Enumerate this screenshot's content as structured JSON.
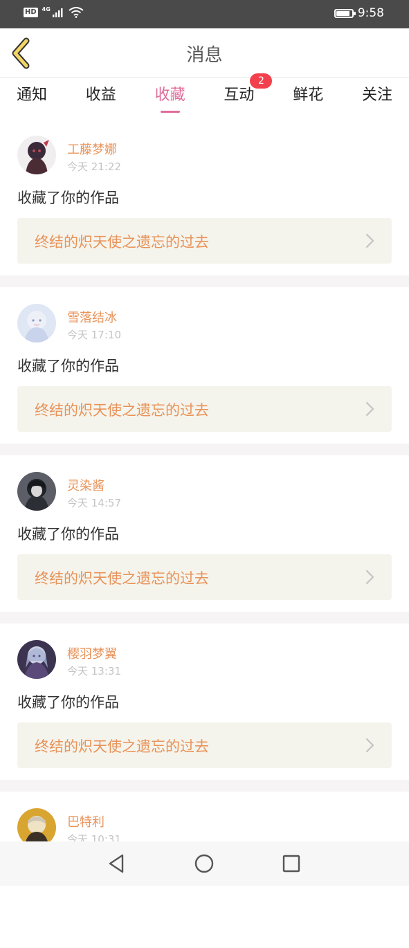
{
  "status_bar": {
    "badge": "HD",
    "network": "4G",
    "battery_level": 0.9,
    "time": "9:58"
  },
  "header": {
    "title": "消息",
    "back_icon": "chevron-left-icon",
    "back_color": "#e8c24a"
  },
  "tabs": [
    {
      "label": "通知"
    },
    {
      "label": "收益"
    },
    {
      "label": "收藏",
      "active": true
    },
    {
      "label": "互动",
      "badge": "2"
    },
    {
      "label": "鲜花"
    },
    {
      "label": "关注"
    }
  ],
  "colors": {
    "accent": "#e06b9a",
    "username": "#e8935a",
    "badge": "#f2414c",
    "card_link_bg": "#f5f4ec"
  },
  "messages": [
    {
      "username": "工藤梦娜",
      "time": "今天 21:22",
      "action": "收藏了你的作品",
      "work_title": "终结的炽天使之遗忘的过去"
    },
    {
      "username": "雪落结冰",
      "time": "今天 17:10",
      "action": "收藏了你的作品",
      "work_title": "终结的炽天使之遗忘的过去"
    },
    {
      "username": "灵染酱",
      "time": "今天 14:57",
      "action": "收藏了你的作品",
      "work_title": "终结的炽天使之遗忘的过去"
    },
    {
      "username": "樱羽梦翼",
      "time": "今天 13:31",
      "action": "收藏了你的作品",
      "work_title": "终结的炽天使之遗忘的过去"
    },
    {
      "username": "巴特利",
      "time": "今天 10:31",
      "action": "",
      "work_title": ""
    }
  ],
  "nav_bar": {
    "back_icon": "triangle-back-icon",
    "home_icon": "circle-home-icon",
    "recents_icon": "square-recents-icon"
  }
}
